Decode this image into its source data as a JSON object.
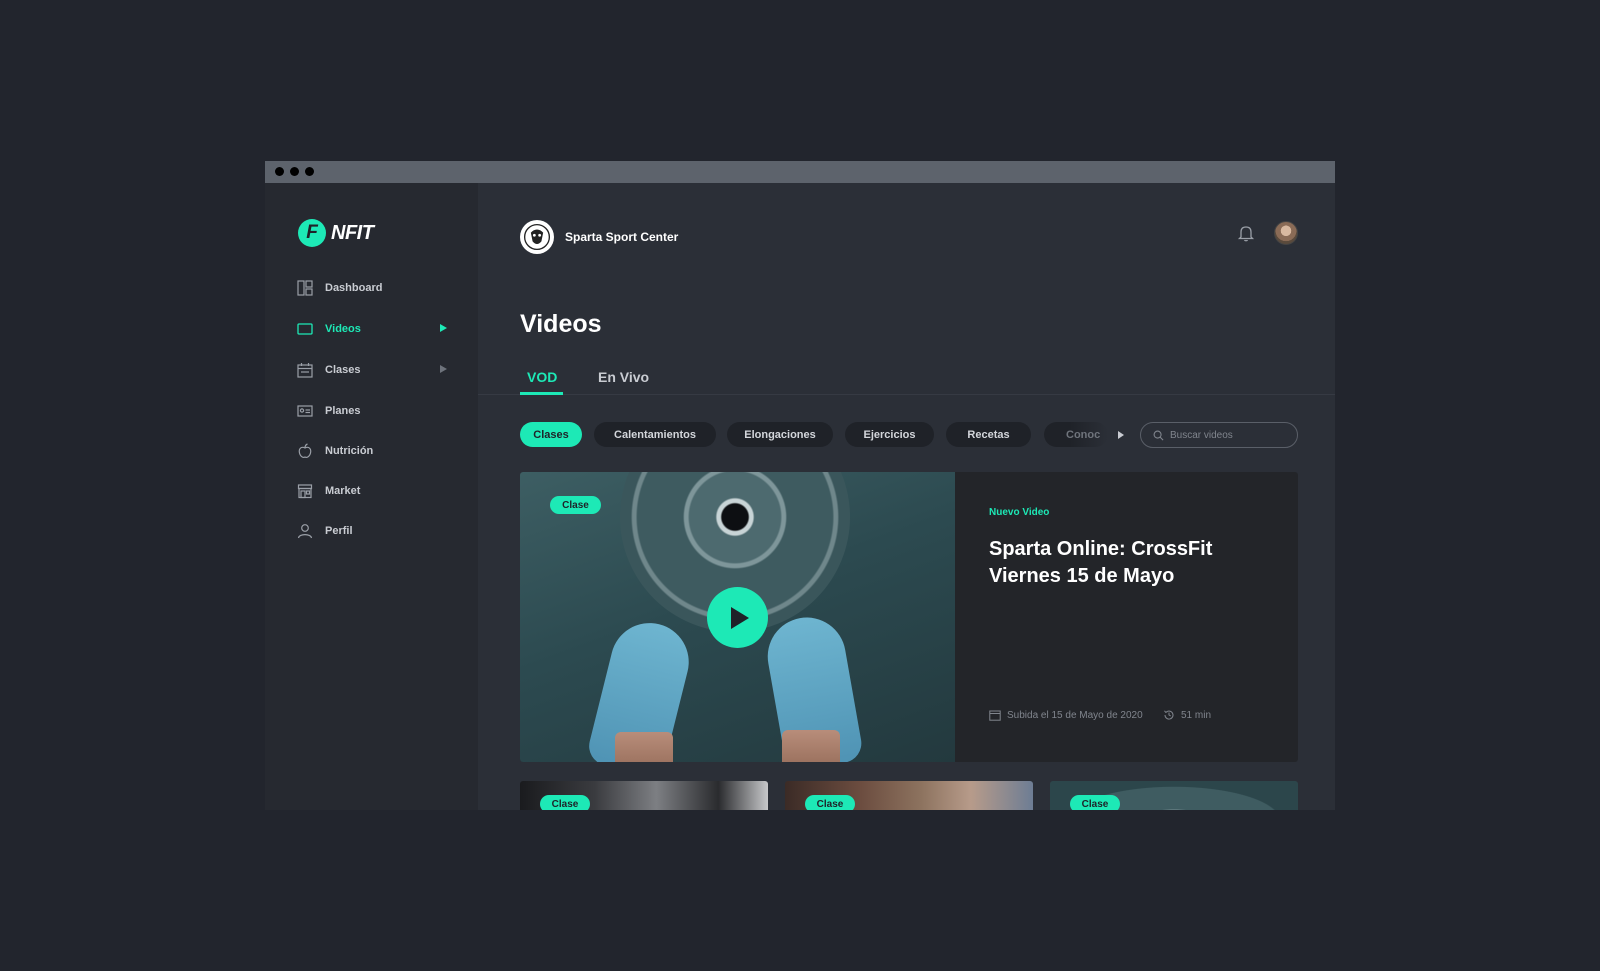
{
  "app": {
    "name": "NFIT",
    "logo_letter": "F"
  },
  "sidebar": {
    "items": [
      {
        "label": "Dashboard",
        "icon": "dashboard-icon"
      },
      {
        "label": "Videos",
        "icon": "video-icon",
        "active": true,
        "expandable": true
      },
      {
        "label": "Clases",
        "icon": "calendar-icon",
        "expandable": true
      },
      {
        "label": "Planes",
        "icon": "id-card-icon"
      },
      {
        "label": "Nutrición",
        "icon": "apple-icon"
      },
      {
        "label": "Market",
        "icon": "store-icon"
      },
      {
        "label": "Perfil",
        "icon": "user-icon"
      }
    ]
  },
  "header": {
    "gym_name": "Sparta Sport Center"
  },
  "page": {
    "title": "Videos",
    "tabs": [
      {
        "label": "VOD",
        "active": true
      },
      {
        "label": "En Vivo"
      }
    ]
  },
  "filters": {
    "chips": [
      {
        "label": "Clases",
        "active": true
      },
      {
        "label": "Calentamientos"
      },
      {
        "label": "Elongaciones"
      },
      {
        "label": "Ejercicios"
      },
      {
        "label": "Recetas"
      },
      {
        "label": "Conoc"
      }
    ],
    "search_placeholder": "Buscar videos"
  },
  "featured": {
    "badge": "Clase",
    "tag": "Nuevo Video",
    "title": "Sparta Online: CrossFit Viernes 15 de Mayo",
    "date": "Subida el 15 de Mayo de 2020",
    "duration": "51 min"
  },
  "thumbnails": [
    {
      "badge": "Clase"
    },
    {
      "badge": "Clase"
    },
    {
      "badge": "Clase"
    }
  ],
  "colors": {
    "accent": "#1de9b6",
    "background": "#22252d",
    "panel": "#2b2f37",
    "sidebar": "#262930"
  }
}
